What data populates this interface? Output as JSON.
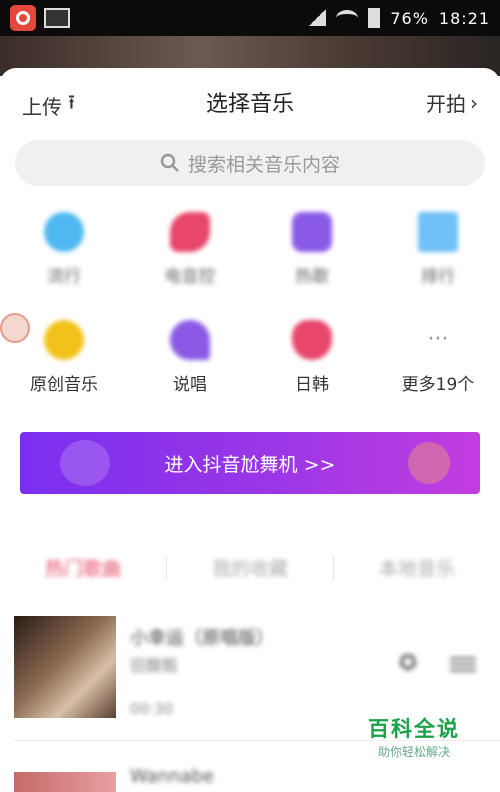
{
  "status_bar": {
    "time": "18:21",
    "battery": "76%"
  },
  "header": {
    "upload_label": "上传",
    "title": "选择音乐",
    "start_label": "开拍"
  },
  "search": {
    "placeholder": "搜索相关音乐内容"
  },
  "categories": [
    {
      "label": "流行",
      "icon": "disc-icon",
      "color": "#4fb8f0"
    },
    {
      "label": "电音控",
      "icon": "guitar-icon",
      "color": "#e8466a"
    },
    {
      "label": "热歌",
      "icon": "robot-icon",
      "color": "#8a5ae6"
    },
    {
      "label": "排行",
      "icon": "grid-icon",
      "color": "#6ec0f5"
    },
    {
      "label": "原创音乐",
      "icon": "music-note-icon",
      "color": "#f2c21a"
    },
    {
      "label": "说唱",
      "icon": "microphone-icon",
      "color": "#8a5ae6"
    },
    {
      "label": "日韩",
      "icon": "heart-icon",
      "color": "#e8466a"
    },
    {
      "label": "更多19个",
      "icon": "more-icon",
      "color": "#aaaaaa"
    }
  ],
  "banner": {
    "label": "进入抖音尬舞机 >>"
  },
  "tabs": [
    {
      "label": "热门歌曲",
      "active": true
    },
    {
      "label": "我的收藏",
      "active": false
    },
    {
      "label": "本地音乐",
      "active": false
    }
  ],
  "songs": [
    {
      "title": "小幸运（原唱版）",
      "artist": "田馥甄",
      "duration": "00:30"
    },
    {
      "title": "Wannabe"
    }
  ],
  "watermark": {
    "title": "百科全说",
    "subtitle": "助你轻松解决"
  }
}
